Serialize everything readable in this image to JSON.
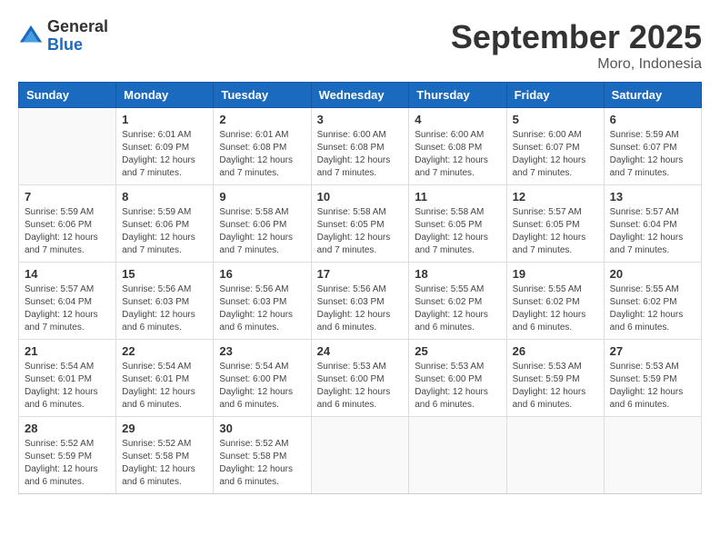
{
  "logo": {
    "general": "General",
    "blue": "Blue"
  },
  "title": "September 2025",
  "location": "Moro, Indonesia",
  "days_of_week": [
    "Sunday",
    "Monday",
    "Tuesday",
    "Wednesday",
    "Thursday",
    "Friday",
    "Saturday"
  ],
  "weeks": [
    [
      {
        "day": "",
        "info": ""
      },
      {
        "day": "1",
        "info": "Sunrise: 6:01 AM\nSunset: 6:09 PM\nDaylight: 12 hours\nand 7 minutes."
      },
      {
        "day": "2",
        "info": "Sunrise: 6:01 AM\nSunset: 6:08 PM\nDaylight: 12 hours\nand 7 minutes."
      },
      {
        "day": "3",
        "info": "Sunrise: 6:00 AM\nSunset: 6:08 PM\nDaylight: 12 hours\nand 7 minutes."
      },
      {
        "day": "4",
        "info": "Sunrise: 6:00 AM\nSunset: 6:08 PM\nDaylight: 12 hours\nand 7 minutes."
      },
      {
        "day": "5",
        "info": "Sunrise: 6:00 AM\nSunset: 6:07 PM\nDaylight: 12 hours\nand 7 minutes."
      },
      {
        "day": "6",
        "info": "Sunrise: 5:59 AM\nSunset: 6:07 PM\nDaylight: 12 hours\nand 7 minutes."
      }
    ],
    [
      {
        "day": "7",
        "info": "Sunrise: 5:59 AM\nSunset: 6:06 PM\nDaylight: 12 hours\nand 7 minutes."
      },
      {
        "day": "8",
        "info": "Sunrise: 5:59 AM\nSunset: 6:06 PM\nDaylight: 12 hours\nand 7 minutes."
      },
      {
        "day": "9",
        "info": "Sunrise: 5:58 AM\nSunset: 6:06 PM\nDaylight: 12 hours\nand 7 minutes."
      },
      {
        "day": "10",
        "info": "Sunrise: 5:58 AM\nSunset: 6:05 PM\nDaylight: 12 hours\nand 7 minutes."
      },
      {
        "day": "11",
        "info": "Sunrise: 5:58 AM\nSunset: 6:05 PM\nDaylight: 12 hours\nand 7 minutes."
      },
      {
        "day": "12",
        "info": "Sunrise: 5:57 AM\nSunset: 6:05 PM\nDaylight: 12 hours\nand 7 minutes."
      },
      {
        "day": "13",
        "info": "Sunrise: 5:57 AM\nSunset: 6:04 PM\nDaylight: 12 hours\nand 7 minutes."
      }
    ],
    [
      {
        "day": "14",
        "info": "Sunrise: 5:57 AM\nSunset: 6:04 PM\nDaylight: 12 hours\nand 7 minutes."
      },
      {
        "day": "15",
        "info": "Sunrise: 5:56 AM\nSunset: 6:03 PM\nDaylight: 12 hours\nand 6 minutes."
      },
      {
        "day": "16",
        "info": "Sunrise: 5:56 AM\nSunset: 6:03 PM\nDaylight: 12 hours\nand 6 minutes."
      },
      {
        "day": "17",
        "info": "Sunrise: 5:56 AM\nSunset: 6:03 PM\nDaylight: 12 hours\nand 6 minutes."
      },
      {
        "day": "18",
        "info": "Sunrise: 5:55 AM\nSunset: 6:02 PM\nDaylight: 12 hours\nand 6 minutes."
      },
      {
        "day": "19",
        "info": "Sunrise: 5:55 AM\nSunset: 6:02 PM\nDaylight: 12 hours\nand 6 minutes."
      },
      {
        "day": "20",
        "info": "Sunrise: 5:55 AM\nSunset: 6:02 PM\nDaylight: 12 hours\nand 6 minutes."
      }
    ],
    [
      {
        "day": "21",
        "info": "Sunrise: 5:54 AM\nSunset: 6:01 PM\nDaylight: 12 hours\nand 6 minutes."
      },
      {
        "day": "22",
        "info": "Sunrise: 5:54 AM\nSunset: 6:01 PM\nDaylight: 12 hours\nand 6 minutes."
      },
      {
        "day": "23",
        "info": "Sunrise: 5:54 AM\nSunset: 6:00 PM\nDaylight: 12 hours\nand 6 minutes."
      },
      {
        "day": "24",
        "info": "Sunrise: 5:53 AM\nSunset: 6:00 PM\nDaylight: 12 hours\nand 6 minutes."
      },
      {
        "day": "25",
        "info": "Sunrise: 5:53 AM\nSunset: 6:00 PM\nDaylight: 12 hours\nand 6 minutes."
      },
      {
        "day": "26",
        "info": "Sunrise: 5:53 AM\nSunset: 5:59 PM\nDaylight: 12 hours\nand 6 minutes."
      },
      {
        "day": "27",
        "info": "Sunrise: 5:53 AM\nSunset: 5:59 PM\nDaylight: 12 hours\nand 6 minutes."
      }
    ],
    [
      {
        "day": "28",
        "info": "Sunrise: 5:52 AM\nSunset: 5:59 PM\nDaylight: 12 hours\nand 6 minutes."
      },
      {
        "day": "29",
        "info": "Sunrise: 5:52 AM\nSunset: 5:58 PM\nDaylight: 12 hours\nand 6 minutes."
      },
      {
        "day": "30",
        "info": "Sunrise: 5:52 AM\nSunset: 5:58 PM\nDaylight: 12 hours\nand 6 minutes."
      },
      {
        "day": "",
        "info": ""
      },
      {
        "day": "",
        "info": ""
      },
      {
        "day": "",
        "info": ""
      },
      {
        "day": "",
        "info": ""
      }
    ]
  ]
}
